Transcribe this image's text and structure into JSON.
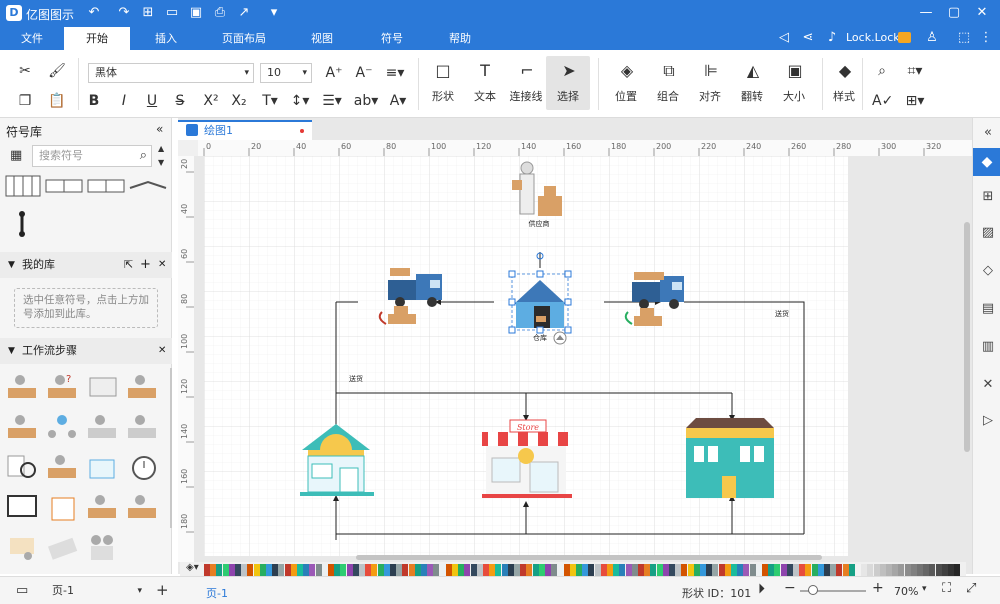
{
  "app": {
    "title": "亿图图示",
    "user": "Lock.Lock"
  },
  "menu": [
    "文件",
    "开始",
    "插入",
    "页面布局",
    "视图",
    "符号",
    "帮助"
  ],
  "ribbon": {
    "font": "黑体",
    "size": "10",
    "tools": [
      "形状",
      "文本",
      "连接线",
      "选择"
    ],
    "arrange": [
      "位置",
      "组合",
      "对齐",
      "翻转",
      "大小"
    ],
    "style": "样式"
  },
  "left": {
    "title": "符号库",
    "search_placeholder": "搜索符号",
    "my_lib": "我的库",
    "my_lib_hint": "选中任意符号，点击上方加号添加到此库。",
    "workflow": "工作流步骤"
  },
  "doc_tab": "绘图1",
  "ruler_h": [
    "0",
    "20",
    "40",
    "60",
    "80",
    "100",
    "120",
    "140",
    "160",
    "180",
    "200",
    "220",
    "240",
    "260",
    "280",
    "300",
    "320"
  ],
  "ruler_v": [
    "20",
    "40",
    "60",
    "80",
    "100",
    "120",
    "140",
    "160",
    "180"
  ],
  "diagram": {
    "supplier": "供应商",
    "warehouse": "仓库",
    "ship1": "送货",
    "ship2": "送货",
    "store_sign": "Store"
  },
  "status": {
    "page_sel": "页-1",
    "page_tab": "页-1",
    "shape_id": "形状 ID：101",
    "zoom": "70%"
  },
  "colors": {
    "accent": "#2b79d8"
  }
}
